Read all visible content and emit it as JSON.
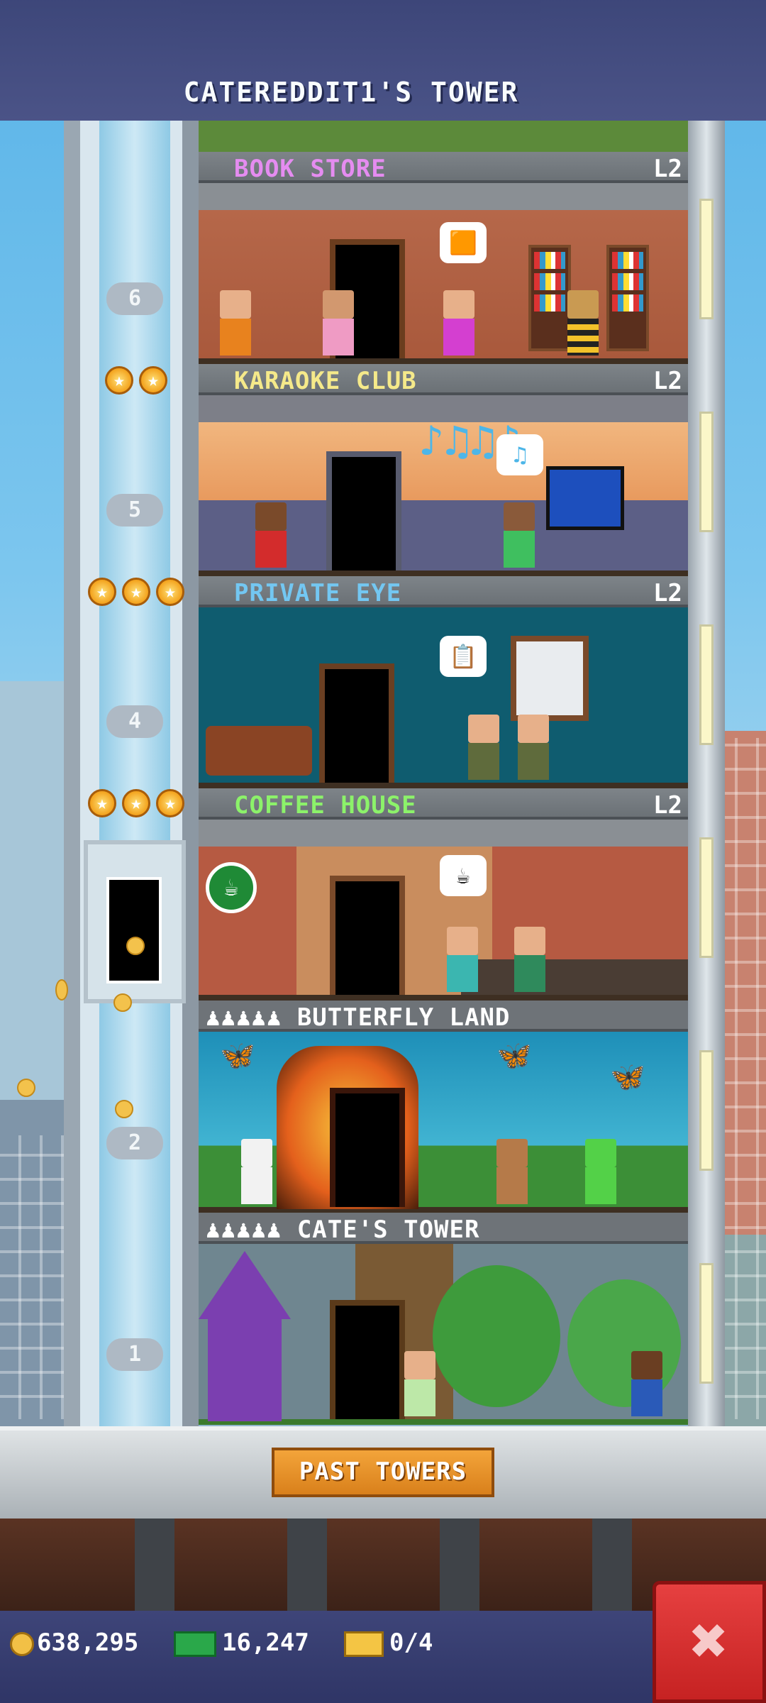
{
  "header": {
    "title": "CATEREDDIT1'S TOWER"
  },
  "elevator": {
    "floor_numbers": [
      "6",
      "5",
      "4",
      "2",
      "1"
    ]
  },
  "floors": [
    {
      "name": "BOOK STORE",
      "level": "L2",
      "color": "#e58cf0"
    },
    {
      "name": "KARAOKE CLUB",
      "level": "L2",
      "color": "#f5e98a"
    },
    {
      "name": "PRIVATE EYE",
      "level": "L2",
      "color": "#73c7f2"
    },
    {
      "name": "COFFEE HOUSE",
      "level": "L2",
      "color": "#8cf26a"
    },
    {
      "name": "♟♟♟♟♟ BUTTERFLY LAND",
      "level": "",
      "color": "#ffffff"
    },
    {
      "name": "♟♟♟♟♟ CATE'S TOWER",
      "level": "",
      "color": "#ffffff"
    }
  ],
  "bottom": {
    "past_towers_label": "PAST TOWERS"
  },
  "status": {
    "coins": "638,295",
    "bux": "16,247",
    "tickets": "0/4"
  },
  "icons": {
    "coin": "coin-icon",
    "bux": "tower-bux-icon",
    "ticket": "ticket-icon",
    "close": "close-icon"
  },
  "colors": {
    "close_button": "#d93131",
    "header": "#414779",
    "past_towers_button": "#e8922a"
  }
}
